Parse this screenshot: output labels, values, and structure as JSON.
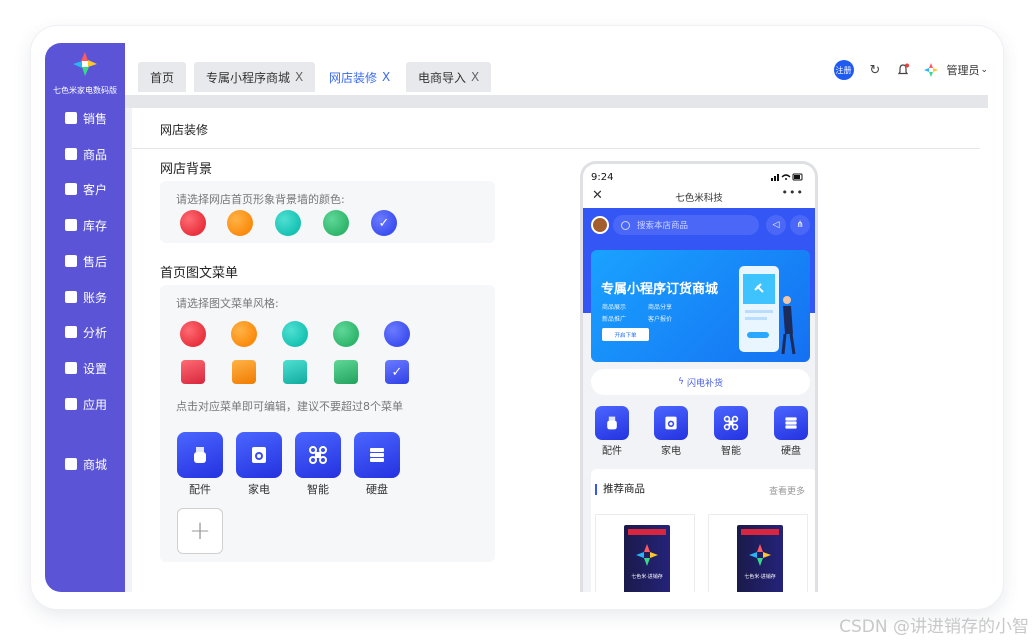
{
  "brand": {
    "name": "七色米家电数码版"
  },
  "sidebar": {
    "items": [
      {
        "label": "销售",
        "icon": "store-icon"
      },
      {
        "label": "商品",
        "icon": "box-icon"
      },
      {
        "label": "客户",
        "icon": "users-icon"
      },
      {
        "label": "库存",
        "icon": "warehouse-icon"
      },
      {
        "label": "售后",
        "icon": "service-icon"
      },
      {
        "label": "账务",
        "icon": "wallet-icon"
      },
      {
        "label": "分析",
        "icon": "chart-icon"
      },
      {
        "label": "设置",
        "icon": "gear-icon"
      },
      {
        "label": "应用",
        "icon": "apps-icon"
      },
      {
        "label": "商城",
        "icon": "shop-bag-icon"
      }
    ]
  },
  "tabs": [
    {
      "label": "首页",
      "closable": false,
      "active": false
    },
    {
      "label": "专属小程序商城",
      "closable": true,
      "active": false
    },
    {
      "label": "网店装修",
      "closable": true,
      "active": true
    },
    {
      "label": "电商导入",
      "closable": true,
      "active": false
    }
  ],
  "tab_close": "X",
  "header": {
    "register": "注册",
    "admin": "管理员"
  },
  "page": {
    "title": "网店装修",
    "background_section": {
      "title": "网店背景",
      "hint": "请选择网店首页形象背景墙的颜色:",
      "colors": [
        "#e8323e",
        "#fb8b0c",
        "#17c2b3",
        "#2fb56b",
        "#3c4ff0"
      ],
      "selected": 4
    },
    "menu_section": {
      "title": "首页图文菜单",
      "hint": "请选择图文菜单风格:",
      "round_colors": [
        "#e8323e",
        "#fb8b0c",
        "#17c2b3",
        "#2fb56b",
        "#3c4ff0"
      ],
      "square_colors": [
        "#e8323e",
        "#fb8b0c",
        "#17c2b3",
        "#2fb56b",
        "#3c4ff0"
      ],
      "selected_square": 4,
      "edit_hint": "点击对应菜单即可编辑，建议不要超过8个菜单",
      "items": [
        {
          "label": "配件",
          "icon": "usb-icon"
        },
        {
          "label": "家电",
          "icon": "washer-icon"
        },
        {
          "label": "智能",
          "icon": "smart-icon"
        },
        {
          "label": "硬盘",
          "icon": "server-icon"
        }
      ],
      "add": "+"
    }
  },
  "phone": {
    "time": "9:24",
    "title": "七色米科技",
    "more": "•••",
    "search_placeholder": "搜索本店商品",
    "banner": {
      "title": "专属小程序订货商城",
      "features": [
        "商品展示",
        "商品分享",
        "新品推广",
        "客户报价"
      ],
      "button": "开启下单"
    },
    "flash": "闪电补货",
    "menu": [
      "配件",
      "家电",
      "智能",
      "硬盘"
    ],
    "recommend": {
      "title": "推荐商品",
      "more": "查看更多"
    },
    "product_text": "七色米·进销存"
  },
  "watermark": "CSDN @讲进销存的小智"
}
